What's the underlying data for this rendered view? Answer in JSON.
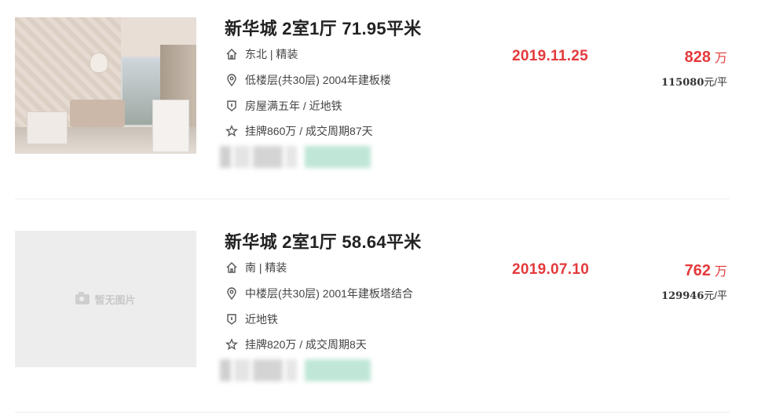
{
  "listings": [
    {
      "title": "新华城 2室1厅 71.95平米",
      "orientation_decor": "东北 | 精装",
      "floor_info": "低楼层(共30层) 2004年建板楼",
      "tags_text": "房屋满五年 / 近地铁",
      "listing_cycle": "挂牌860万 / 成交周期87天",
      "deal_date": "2019.11.25",
      "total_price": "828",
      "total_unit": "万",
      "unit_price": "115080",
      "unit_price_suffix": "元/平",
      "has_photo": true
    },
    {
      "title": "新华城 2室1厅 58.64平米",
      "orientation_decor": "南 | 精装",
      "floor_info": "中楼层(共30层) 2001年建板塔结合",
      "tags_text": "近地铁",
      "listing_cycle": "挂牌820万 / 成交周期8天",
      "deal_date": "2019.07.10",
      "total_price": "762",
      "total_unit": "万",
      "unit_price": "129946",
      "unit_price_suffix": "元/平",
      "has_photo": false,
      "no_photo_label": "暂无图片"
    }
  ],
  "colors": {
    "accent_red": "#e4393c",
    "title": "#222222",
    "muted": "#444444"
  },
  "icons": [
    "home-icon",
    "location-pin-icon",
    "shield-icon",
    "star-icon",
    "camera-icon"
  ]
}
